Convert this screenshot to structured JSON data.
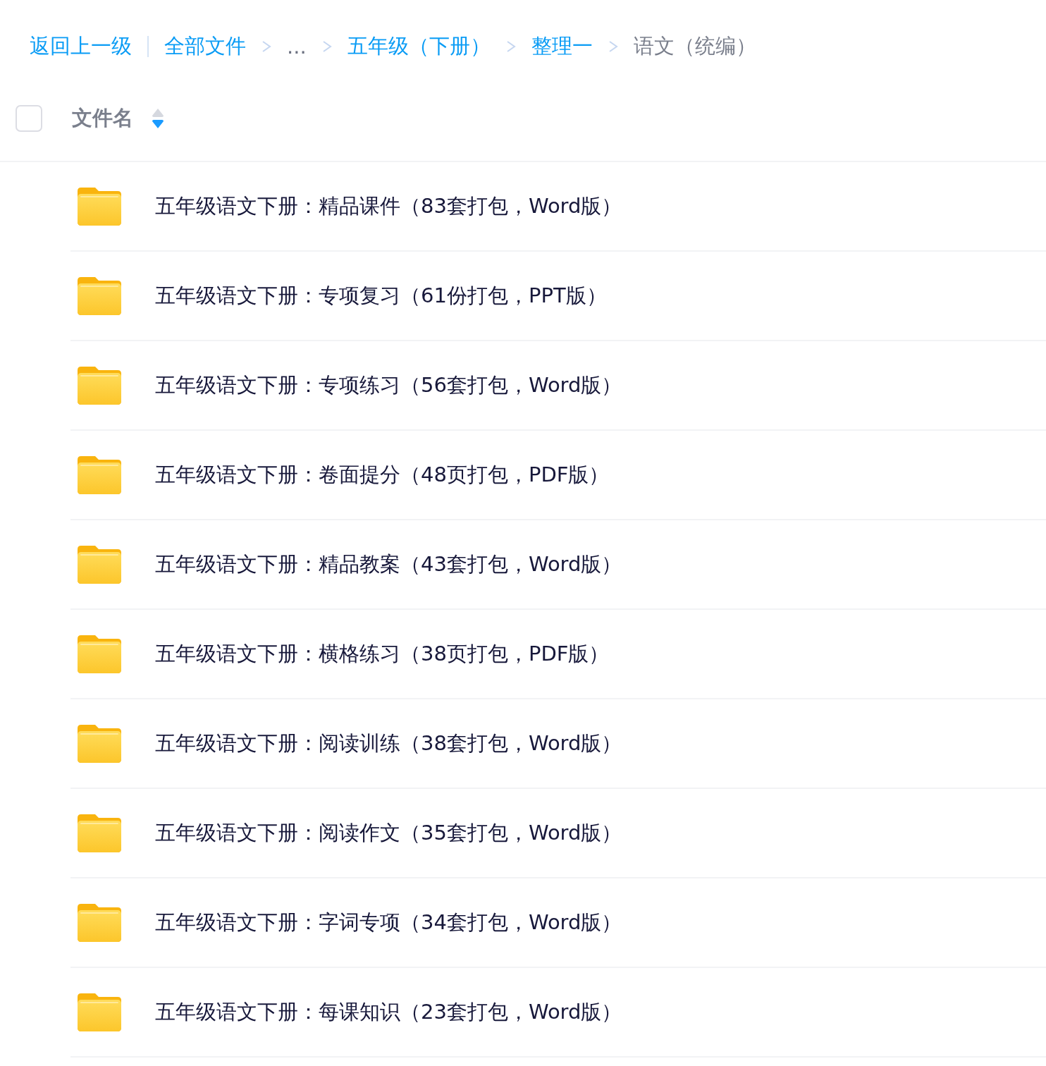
{
  "breadcrumb": {
    "back": "返回上一级",
    "items": [
      {
        "kind": "link",
        "label": "全部文件"
      },
      {
        "kind": "ellipsis",
        "label": "..."
      },
      {
        "kind": "link",
        "label": "五年级（下册）"
      },
      {
        "kind": "link",
        "label": "整理一"
      },
      {
        "kind": "current",
        "label": "语文（统编）"
      }
    ]
  },
  "table": {
    "select_all": {
      "checked": false
    },
    "column": {
      "label": "文件名",
      "sorted_descending": true
    },
    "rows": [
      {
        "name": "五年级语文下册：精品课件（83套打包，Word版）"
      },
      {
        "name": "五年级语文下册：专项复习（61份打包，PPT版）"
      },
      {
        "name": "五年级语文下册：专项练习（56套打包，Word版）"
      },
      {
        "name": "五年级语文下册：卷面提分（48页打包，PDF版）"
      },
      {
        "name": "五年级语文下册：精品教案（43套打包，Word版）"
      },
      {
        "name": "五年级语文下册：横格练习（38页打包，PDF版）"
      },
      {
        "name": "五年级语文下册：阅读训练（38套打包，Word版）"
      },
      {
        "name": "五年级语文下册：阅读作文（35套打包，Word版）"
      },
      {
        "name": "五年级语文下册：字词专项（34套打包，Word版）"
      },
      {
        "name": "五年级语文下册：每课知识（23套打包，Word版）"
      }
    ]
  }
}
